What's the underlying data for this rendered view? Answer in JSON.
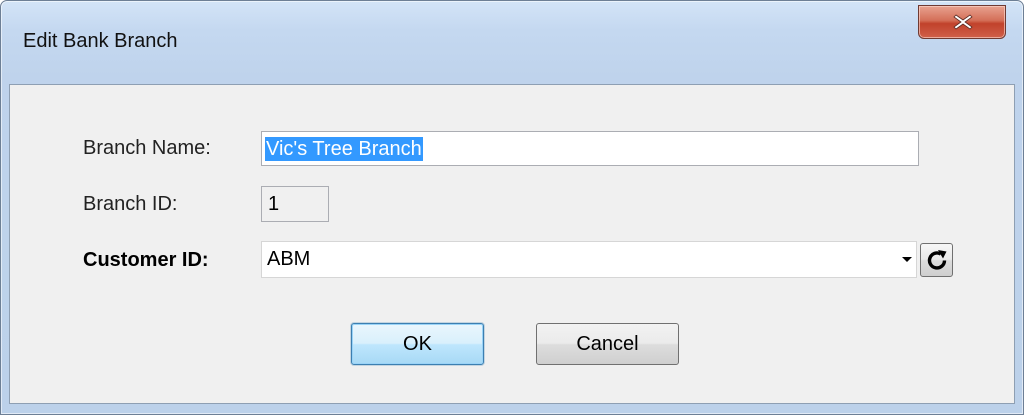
{
  "window": {
    "title": "Edit Bank Branch",
    "close_icon": "close-x-icon"
  },
  "form": {
    "branch_name": {
      "label": "Branch Name:",
      "value": "Vic's Tree Branch",
      "selected": true
    },
    "branch_id": {
      "label": "Branch ID:",
      "value": "1",
      "readonly": true
    },
    "customer_id": {
      "label": "Customer ID:",
      "value": "ABM",
      "dropdown_icon": "chevron-down-icon",
      "refresh_icon": "refresh-icon"
    }
  },
  "buttons": {
    "ok_label": "OK",
    "cancel_label": "Cancel"
  },
  "colors": {
    "selection": "#3399ff",
    "close_button": "#c7503a",
    "default_button_border": "#3c7fb1"
  }
}
